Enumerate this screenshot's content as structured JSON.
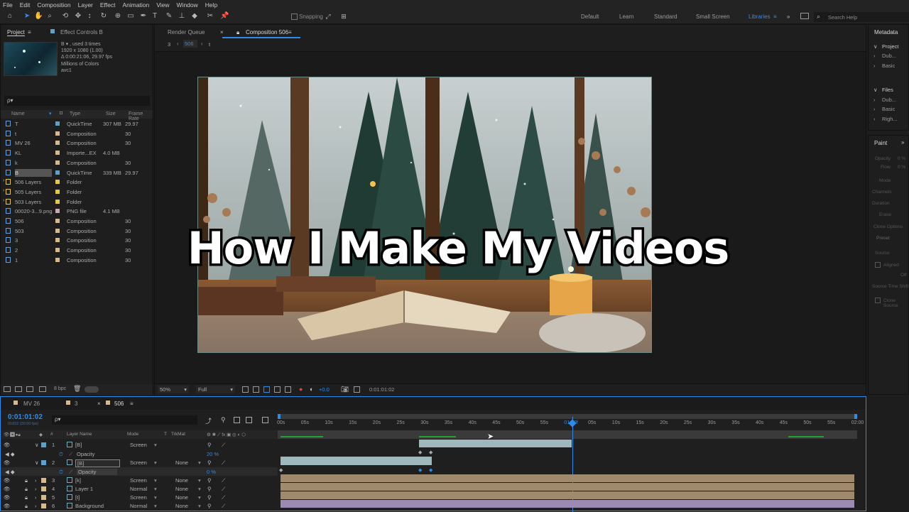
{
  "menu": [
    "File",
    "Edit",
    "Composition",
    "Layer",
    "Effect",
    "Animation",
    "View",
    "Window",
    "Help"
  ],
  "toolbar": {
    "snapping": "Snapping",
    "workspaces": [
      "Default",
      "Learn",
      "Standard",
      "Small Screen",
      "Libraries"
    ],
    "active_workspace": "Libraries",
    "search_placeholder": "Search Help"
  },
  "project": {
    "tab": "Project",
    "effect_tab": "Effect Controls B",
    "info": [
      "B ▾ , used 3 times",
      "1920 x 1080 (1.00)",
      "Δ 0:00:21:06, 29.97 fps",
      "Millions of Colors",
      "avc1"
    ],
    "search_placeholder": "ρ▾",
    "columns": {
      "name": "Name",
      "type": "Type",
      "size": "Size",
      "rate": "Frame Rate"
    },
    "bpc": "8 bpc",
    "items": [
      {
        "name": "T",
        "type": "QuickTime",
        "size": "307 MB",
        "rate": "29.97",
        "color": "#5fa0c8",
        "folder": false
      },
      {
        "name": "t",
        "type": "Composition",
        "size": "",
        "rate": "30",
        "color": "#d8b98a",
        "folder": false
      },
      {
        "name": "MV 26",
        "type": "Composition",
        "size": "",
        "rate": "30",
        "color": "#d8b98a",
        "folder": false
      },
      {
        "name": "KL",
        "type": "Importe...EX",
        "size": "4.0 MB",
        "rate": "",
        "color": "#d8b98a",
        "folder": false
      },
      {
        "name": "k",
        "type": "Composition",
        "size": "",
        "rate": "30",
        "color": "#d8b98a",
        "folder": false
      },
      {
        "name": "B",
        "type": "QuickTime",
        "size": "339 MB",
        "rate": "29.97",
        "color": "#5fa0c8",
        "folder": false
      },
      {
        "name": "506 Layers",
        "type": "Folder",
        "size": "",
        "rate": "",
        "color": "#e5c74a",
        "folder": true
      },
      {
        "name": "505 Layers",
        "type": "Folder",
        "size": "",
        "rate": "",
        "color": "#e5c74a",
        "folder": true
      },
      {
        "name": "503 Layers",
        "type": "Folder",
        "size": "",
        "rate": "",
        "color": "#e5c74a",
        "folder": true
      },
      {
        "name": "00020-3...9.png",
        "type": "PNG file",
        "size": "4.1 MB",
        "rate": "",
        "color": "#c8a6b8",
        "folder": false
      },
      {
        "name": "506",
        "type": "Composition",
        "size": "",
        "rate": "30",
        "color": "#d8b98a",
        "folder": false
      },
      {
        "name": "503",
        "type": "Composition",
        "size": "",
        "rate": "30",
        "color": "#d8b98a",
        "folder": false
      },
      {
        "name": "3",
        "type": "Composition",
        "size": "",
        "rate": "30",
        "color": "#d8b98a",
        "folder": false
      },
      {
        "name": "2",
        "type": "Composition",
        "size": "",
        "rate": "30",
        "color": "#d8b98a",
        "folder": false
      },
      {
        "name": "1",
        "type": "Composition",
        "size": "",
        "rate": "30",
        "color": "#d8b98a",
        "folder": false
      }
    ]
  },
  "viewer": {
    "tabs": [
      "Render Queue",
      "Composition 506"
    ],
    "breadcrumb": [
      "3",
      "506",
      "t"
    ],
    "overlay_text": "How I Make My Videos",
    "zoom": "50%",
    "resolution": "Full",
    "exposure": "+0.0",
    "timecode": "0:01:01:02"
  },
  "side": {
    "metadata_tab": "Metadata",
    "project_head": "Project",
    "project_items": [
      "Dub...",
      "Basic"
    ],
    "files_head": "Files",
    "files_items": [
      "Dub...",
      "Basic",
      "Righ..."
    ],
    "paint_tab": "Paint",
    "paint_fields": [
      "Opacity",
      "Flow",
      "Mode",
      "Channels",
      "Duration",
      "Erase",
      "Clone Options",
      "Preset",
      "Source",
      "Aligned",
      "Off",
      "Source Time Shift",
      "Clone Source"
    ],
    "paint_values": [
      "0 %",
      "0 %"
    ]
  },
  "timeline": {
    "tabs": [
      "MV 26",
      "3",
      "506"
    ],
    "timecode": "0:01:01:02",
    "frames": "01832 (30.00 fps)",
    "search_placeholder": "ρ▾",
    "headers": {
      "layer_name": "Layer Name",
      "mode": "Mode",
      "t": "T",
      "trkmat": "TrkMat"
    },
    "ruler": [
      "00s",
      "05s",
      "10s",
      "15s",
      "20s",
      "25s",
      "30s",
      "35s",
      "40s",
      "45s",
      "50s",
      "55s",
      "01:00f",
      "05s",
      "10s",
      "15s",
      "20s",
      "25s",
      "30s",
      "35s",
      "40s",
      "45s",
      "50s",
      "55s",
      "02:00"
    ],
    "layers": [
      {
        "num": "1",
        "name": "[B]",
        "mode": "Screen",
        "trkmat": "",
        "color": "#5fa0c8"
      },
      {
        "num": "",
        "name": "Opacity",
        "mode": "",
        "trkmat": "",
        "color": "",
        "value": "20 %"
      },
      {
        "num": "2",
        "name": "[B]",
        "mode": "Screen",
        "trkmat": "None",
        "color": "#5fa0c8"
      },
      {
        "num": "",
        "name": "Opacity",
        "mode": "",
        "trkmat": "",
        "color": "",
        "value": "0 %"
      },
      {
        "num": "3",
        "name": "[k]",
        "mode": "Screen",
        "trkmat": "None",
        "color": "#d8b98a"
      },
      {
        "num": "4",
        "name": "Layer 1",
        "mode": "Normal",
        "trkmat": "None",
        "color": "#d8b98a"
      },
      {
        "num": "5",
        "name": "[t]",
        "mode": "Screen",
        "trkmat": "None",
        "color": "#d8b98a"
      },
      {
        "num": "6",
        "name": "Background",
        "mode": "Normal",
        "trkmat": "None",
        "color": "#d8b98a"
      }
    ]
  }
}
